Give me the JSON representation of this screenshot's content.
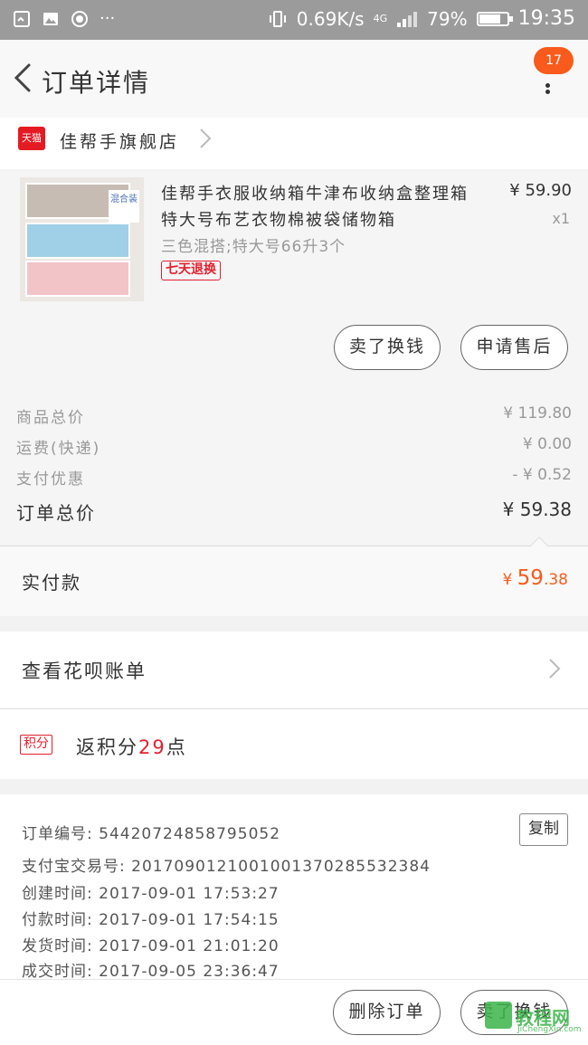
{
  "status_bar": {
    "speed": "0.69K/s",
    "network": "4G",
    "battery": "79%",
    "battery_level": 0.79,
    "time": "19:35"
  },
  "nav": {
    "title": "订单详情",
    "badge_count": "17"
  },
  "shop": {
    "badge": "天猫",
    "name": "佳帮手旗舰店"
  },
  "product": {
    "title": "佳帮手衣服收纳箱牛津布收纳盒整理箱特大号布艺衣物棉被袋储物箱",
    "sku": "三色混搭;特大号66升3个",
    "tag": "七天退换",
    "price": "¥ 59.90",
    "quantity": "x1",
    "image_label": "混合装",
    "sell_button": "卖了换钱",
    "after_sale_button": "申请售后"
  },
  "summary": {
    "rows": [
      {
        "label": "商品总价",
        "value": "¥ 119.80"
      },
      {
        "label": "运费(快递)",
        "value": "¥ 0.00"
      },
      {
        "label": "支付优惠",
        "value": "- ¥ 0.52"
      }
    ],
    "total_label": "订单总价",
    "total_value": "¥ 59.38"
  },
  "paid": {
    "label": "实付款",
    "currency": "¥ ",
    "integer": "59",
    "decimal": ".38"
  },
  "huabei": {
    "label": "查看花呗账单"
  },
  "points": {
    "tag": "积分",
    "prefix": "返积分",
    "amount": "29",
    "suffix": "点"
  },
  "order_info": {
    "rows": [
      {
        "label": "订单编号: ",
        "value": "54420724858795052"
      },
      {
        "label": "支付宝交易号: ",
        "value": "2017090121001001370285532384"
      },
      {
        "label": "创建时间: ",
        "value": "2017-09-01 17:53:27"
      },
      {
        "label": "付款时间: ",
        "value": "2017-09-01 17:54:15"
      },
      {
        "label": "发货时间: ",
        "value": "2017-09-01 21:01:20"
      },
      {
        "label": "成交时间: ",
        "value": "2017-09-05 23:36:47"
      }
    ],
    "copy_button": "复制"
  },
  "bottom": {
    "delete_button": "删除订单",
    "sell_button": "卖了换钱"
  },
  "watermark": {
    "text": "教程网",
    "sub": "JiChengXin.com"
  },
  "colors": {
    "accent": "#f85b1c",
    "tmall_red": "#e5202e",
    "status_bar": "#9b9b9b"
  }
}
